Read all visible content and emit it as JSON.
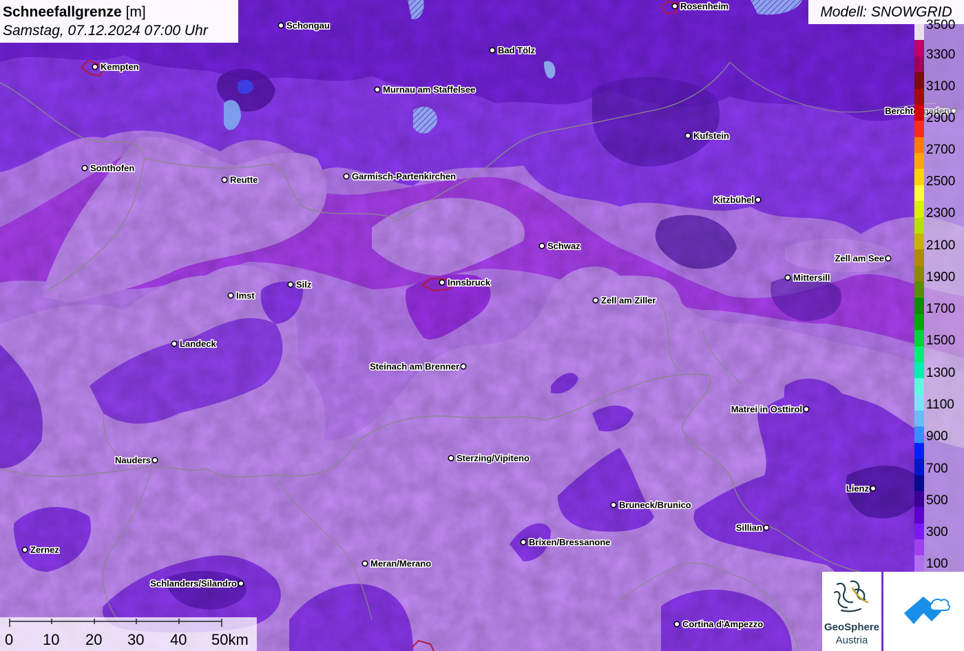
{
  "header": {
    "title": "Schneefallgrenze",
    "unit": "[m]",
    "datetime": "Samstag, 07.12.2024 07:00 Uhr"
  },
  "model": {
    "label": "Modell: SNOWGRID"
  },
  "legend": {
    "labels": [
      "3500",
      "3300",
      "3100",
      "2900",
      "2700",
      "2500",
      "2300",
      "2100",
      "1900",
      "1700",
      "1500",
      "1300",
      "1100",
      "900",
      "700",
      "500",
      "300",
      "100"
    ],
    "colors": [
      "#e8e0f0",
      "#c2006a",
      "#a3005a",
      "#7a0b12",
      "#a30a12",
      "#d4000d",
      "#ff2a1a",
      "#ff7a00",
      "#ffa800",
      "#ffd400",
      "#ffff33",
      "#d9f000",
      "#b8e000",
      "#c8b400",
      "#b08a00",
      "#8c8a00",
      "#5c8c00",
      "#118c00",
      "#00a800",
      "#00d43a",
      "#00ec7a",
      "#00f0b0",
      "#60f6e0",
      "#80e0f8",
      "#70b8f8",
      "#3a8cff",
      "#0022ff",
      "#0018c8",
      "#0a0a90",
      "#3c0099",
      "#5c00cc",
      "#7a1af0",
      "#a040f0",
      "#b070f0"
    ]
  },
  "cities": [
    {
      "name": "Rosenheim"
    },
    {
      "name": "Schongau"
    },
    {
      "name": "Bad Tölz"
    },
    {
      "name": "Kempten"
    },
    {
      "name": "Murnau am Staffelsee"
    },
    {
      "name": "Berchtesgaden"
    },
    {
      "name": "Kufstein"
    },
    {
      "name": "Sonthofen"
    },
    {
      "name": "Reutte"
    },
    {
      "name": "Garmisch-Partenkirchen"
    },
    {
      "name": "Kitzbühel"
    },
    {
      "name": "Schwaz"
    },
    {
      "name": "Zell am See"
    },
    {
      "name": "Mittersill"
    },
    {
      "name": "Silz"
    },
    {
      "name": "Innsbruck"
    },
    {
      "name": "Imst"
    },
    {
      "name": "Zell am Ziller"
    },
    {
      "name": "Landeck"
    },
    {
      "name": "Steinach am Brenner"
    },
    {
      "name": "Matrei in Osttirol"
    },
    {
      "name": "Nauders"
    },
    {
      "name": "Sterzing/Vipiteno"
    },
    {
      "name": "Lienz"
    },
    {
      "name": "Bruneck/Brunico"
    },
    {
      "name": "Sillian"
    },
    {
      "name": "Zernez"
    },
    {
      "name": "Brixen/Bressanone"
    },
    {
      "name": "Meran/Merano"
    },
    {
      "name": "Schlanders/Silandro"
    },
    {
      "name": "Cortina d'Ampezzo"
    }
  ],
  "scale": {
    "labels": [
      "0",
      "10",
      "20",
      "30",
      "40",
      "50km"
    ]
  },
  "logos": {
    "geosphere_line1": "GeoSphere",
    "geosphere_line2": "Austria"
  }
}
